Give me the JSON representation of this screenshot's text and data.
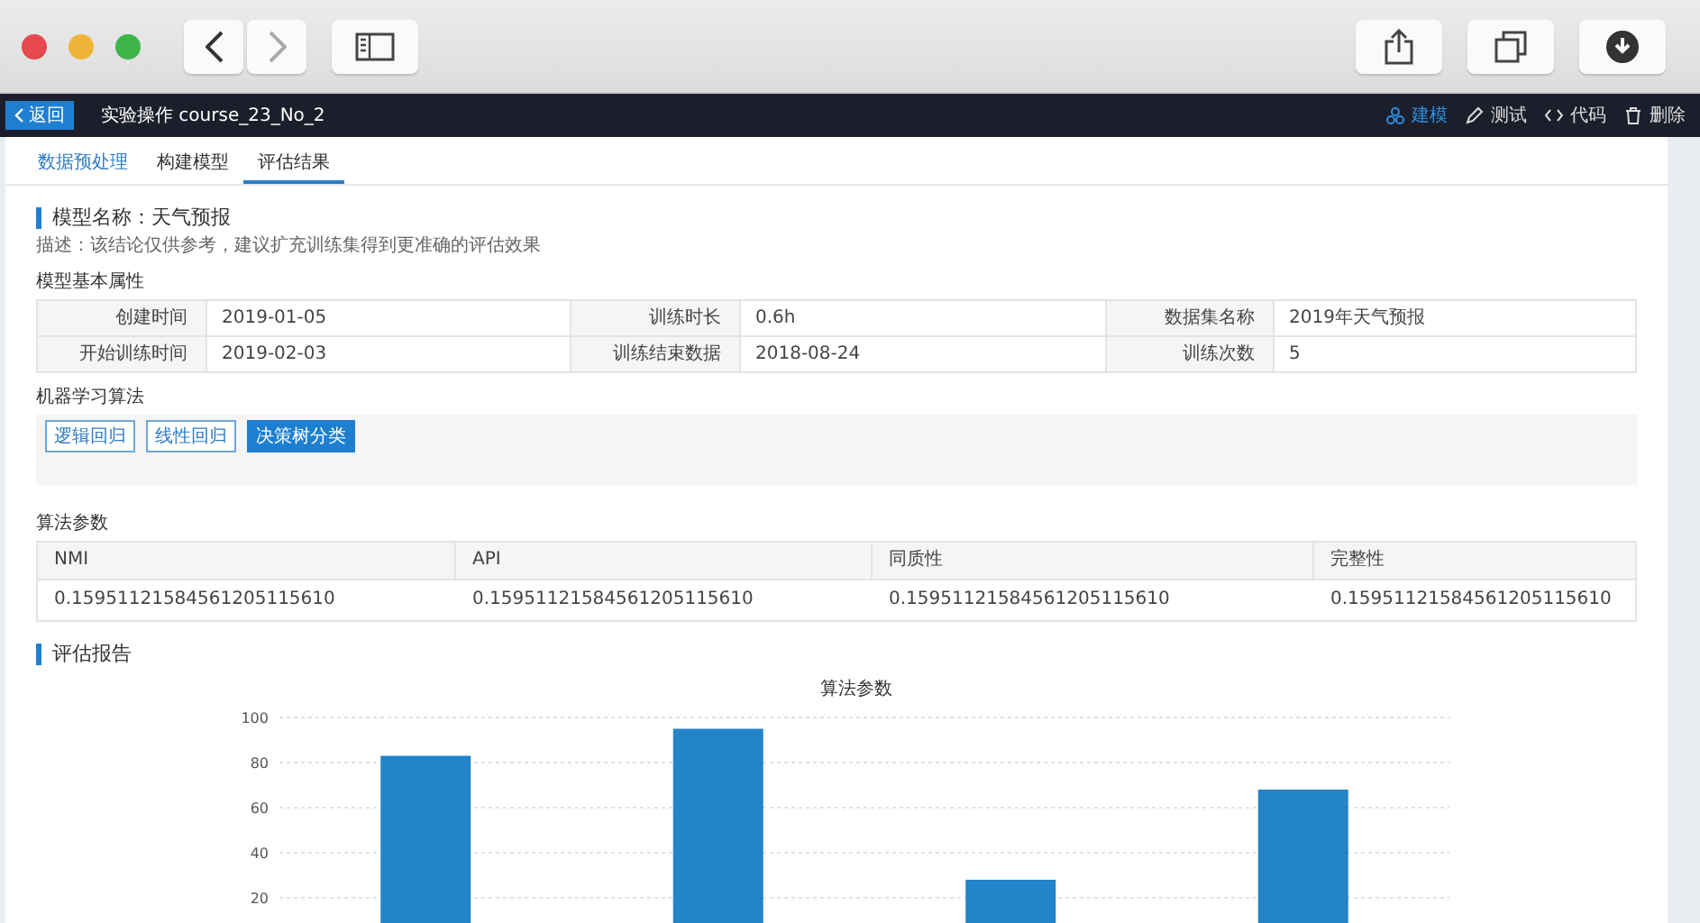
{
  "header": {
    "back_label": "返回",
    "title": "实验操作 course_23_No_2",
    "actions": [
      {
        "label": "建模",
        "selected": true
      },
      {
        "label": "测试",
        "selected": false
      },
      {
        "label": "代码",
        "selected": false
      },
      {
        "label": "删除",
        "selected": false
      }
    ]
  },
  "tabs": [
    {
      "label": "数据预处理",
      "selected": false,
      "hovered": true
    },
    {
      "label": "构建模型",
      "selected": false,
      "hovered": false
    },
    {
      "label": "评估结果",
      "selected": true,
      "hovered": false
    }
  ],
  "model": {
    "title": "模型名称：天气预报",
    "description": "描述：该结论仅供参考，建议扩充训练集得到更准确的评估效果"
  },
  "properties": {
    "heading": "模型基本属性",
    "rows": [
      [
        {
          "label": "创建时间",
          "value": "2019-01-05"
        },
        {
          "label": "训练时长",
          "value": "0.6h"
        },
        {
          "label": "数据集名称",
          "value": "2019年天气预报"
        }
      ],
      [
        {
          "label": "开始训练时间",
          "value": "2019-02-03"
        },
        {
          "label": "训练结束数据",
          "value": "2018-08-24"
        },
        {
          "label": "训练次数",
          "value": "5"
        }
      ]
    ]
  },
  "algorithms": {
    "heading": "机器学习算法",
    "items": [
      {
        "label": "逻辑回归",
        "selected": false
      },
      {
        "label": "线性回归",
        "selected": false
      },
      {
        "label": "决策树分类",
        "selected": true
      }
    ]
  },
  "params": {
    "heading": "算法参数",
    "columns": [
      "NMI",
      "API",
      "同质性",
      "完整性"
    ],
    "rows": [
      [
        "0.15951121584561205115610",
        "0.15951121584561205115610",
        "0.15951121584561205115610",
        "0.15951121584561205115610"
      ]
    ]
  },
  "report": {
    "heading": "评估报告",
    "chart_data": {
      "type": "bar",
      "title": "算法参数",
      "values": [
        83,
        95,
        28,
        68
      ],
      "ylim": [
        0,
        100
      ],
      "grid": true,
      "yticks": [
        20,
        40,
        60,
        80,
        100
      ]
    }
  }
}
